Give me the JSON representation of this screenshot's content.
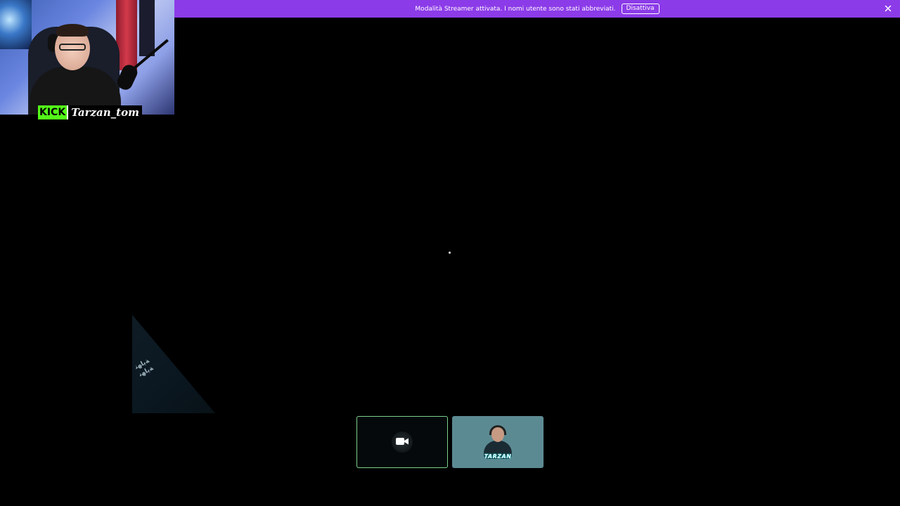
{
  "banner": {
    "message": "Modalità Streamer attivata. I nomi utente sono stati abbreviati.",
    "disable_label": "Disattiva",
    "close_icon": "close-icon",
    "background_color": "#8c3be8"
  },
  "webcam": {
    "platform_label": "KICK",
    "streamer_name": "Tarzan_tom",
    "platform_color": "#53fc18"
  },
  "faded_overlay": {
    "line1": "ﺔﻳﺎﻬﻧ",
    "line2": "ﺔﻳﺎﻬﻧ"
  },
  "participants": [
    {
      "type": "camera",
      "icon": "video-camera-icon",
      "border_color": "#7bd18d"
    },
    {
      "type": "avatar",
      "label": "TARZAN",
      "background_color": "#5c8a93"
    }
  ]
}
